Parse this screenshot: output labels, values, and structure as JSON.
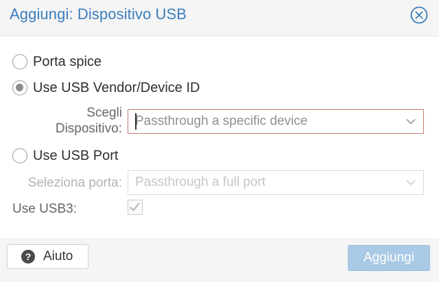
{
  "dialog": {
    "title": "Aggiungi: Dispositivo USB"
  },
  "options": {
    "spice_label": "Porta spice",
    "vendor_label": "Use USB Vendor/Device ID",
    "port_label": "Use USB Port",
    "selected": "vendor"
  },
  "device_field": {
    "label_line1": "Scegli",
    "label_line2": "Dispositivo:",
    "placeholder": "Passthrough a specific device",
    "value": ""
  },
  "port_field": {
    "label": "Seleziona porta:",
    "placeholder": "Passthrough a full port",
    "value": ""
  },
  "usb3": {
    "label": "Use USB3:",
    "checked": true
  },
  "footer": {
    "help_label": "Aiuto",
    "add_label": "Aggiungi"
  },
  "icons": {
    "close": "close-circle-icon",
    "help": "question-circle-icon",
    "caret": "chevron-down-icon",
    "check": "check-icon"
  },
  "colors": {
    "title": "#3a7dbd",
    "invalid_border": "#c0806e",
    "primary_disabled": "#a9c9e6"
  }
}
